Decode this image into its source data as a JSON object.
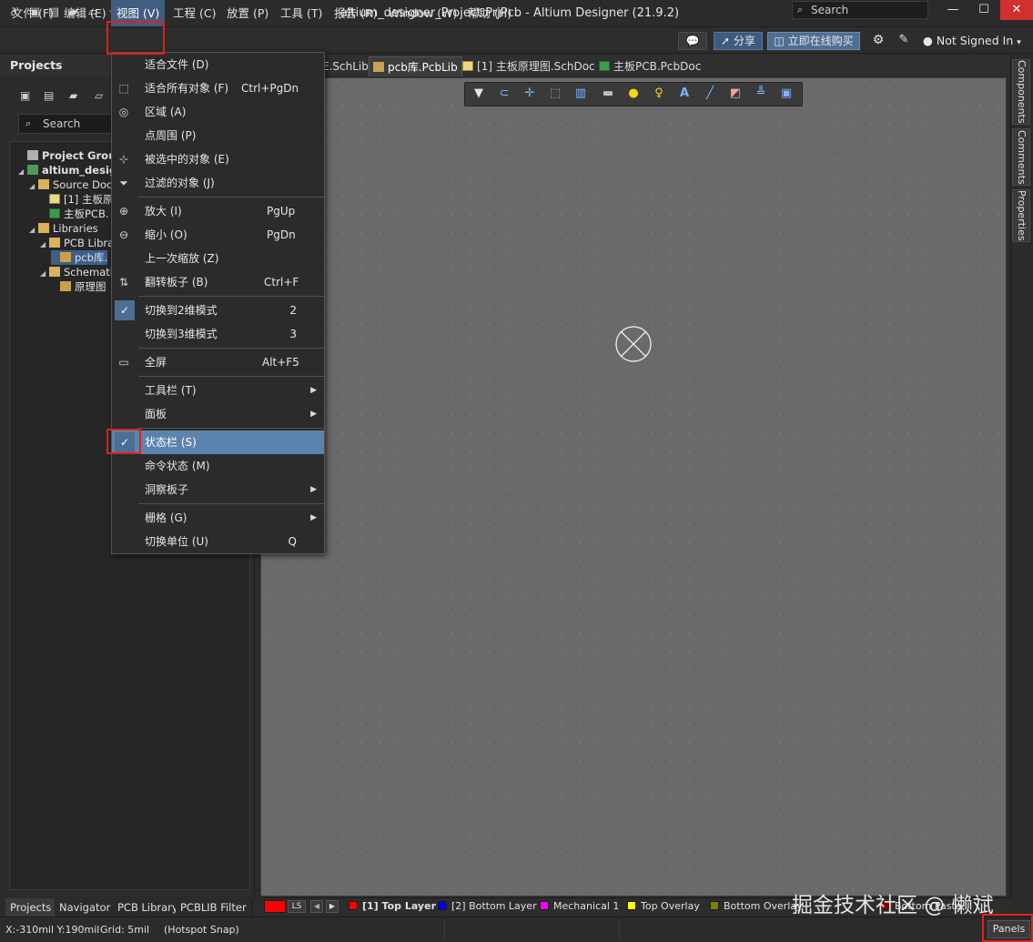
{
  "window": {
    "title": "altium_designer_Project.PrjPcb - Altium Designer (21.9.2)",
    "search_placeholder": "Search",
    "minimize": "—",
    "maximize": "☐",
    "close": "✕"
  },
  "menubar": {
    "items": [
      "文件 (F)",
      "编辑 (E)",
      "视图 (V)",
      "工程 (C)",
      "放置 (P)",
      "工具 (T)",
      "报告 (R)",
      "Window (W)",
      "帮助 (H)"
    ],
    "active_index": 2,
    "share_label": "分享",
    "buy_label": "立即在线购买",
    "signin_label": "Not Signed In"
  },
  "projects_panel": {
    "title": "Projects",
    "search_placeholder": "Search",
    "tree": [
      {
        "label": "Project Group 1.",
        "level": 0,
        "icon": "group",
        "bold": true
      },
      {
        "label": "altium_design",
        "level": 0,
        "icon": "proj",
        "bold": true,
        "tri": "◢"
      },
      {
        "label": "Source Docu",
        "level": 1,
        "icon": "folder",
        "tri": "◢"
      },
      {
        "label": "[1] 主板原",
        "level": 2,
        "icon": "sch"
      },
      {
        "label": "主板PCB.",
        "level": 2,
        "icon": "pcb"
      },
      {
        "label": "Libraries",
        "level": 1,
        "icon": "folder",
        "tri": "◢"
      },
      {
        "label": "PCB Libra",
        "level": 2,
        "icon": "folder",
        "tri": "◢"
      },
      {
        "label": "pcb库.",
        "level": 3,
        "icon": "lib",
        "selected": true
      },
      {
        "label": "Schematic",
        "level": 2,
        "icon": "folder",
        "tri": "◢"
      },
      {
        "label": "原理图",
        "level": 3,
        "icon": "lib"
      }
    ],
    "bottom_tabs": [
      "Projects",
      "Navigator",
      "PCB Library",
      "PCBLIB Filter"
    ]
  },
  "doc_tabs": [
    {
      "label": "E.SchLib"
    },
    {
      "label": "pcb库.PcbLib",
      "active": true
    },
    {
      "label": "[1] 主板原理图.SchDoc"
    },
    {
      "label": "主板PCB.PcbDoc"
    }
  ],
  "right_panels": [
    "Components",
    "Comments",
    "Properties"
  ],
  "view_menu": {
    "items": [
      {
        "label": "适合文件 (D)",
        "shortcut": "",
        "icon": ""
      },
      {
        "label": "适合所有对象 (F)",
        "shortcut": "Ctrl+PgDn",
        "icon": "fit-all-icon"
      },
      {
        "label": "区域 (A)",
        "shortcut": "",
        "icon": "area-icon"
      },
      {
        "label": "点周围 (P)",
        "shortcut": "",
        "icon": ""
      },
      {
        "label": "被选中的对象 (E)",
        "shortcut": "",
        "icon": "selected-icon"
      },
      {
        "label": "过滤的对象 (J)",
        "shortcut": "",
        "icon": "filter-icon"
      },
      {
        "label": "放大 (I)",
        "shortcut": "PgUp",
        "icon": "zoom-in-icon"
      },
      {
        "label": "缩小 (O)",
        "shortcut": "PgDn",
        "icon": "zoom-out-icon"
      },
      {
        "label": "上一次缩放 (Z)",
        "shortcut": "",
        "icon": ""
      },
      {
        "label": "翻转板子 (B)",
        "shortcut": "Ctrl+F",
        "icon": "flip-board-icon"
      },
      {
        "label": "切换到2维模式",
        "shortcut": "2",
        "checked": true
      },
      {
        "label": "切换到3维模式",
        "shortcut": "3"
      },
      {
        "label": "全屏",
        "shortcut": "Alt+F5",
        "icon": "fullscreen-icon"
      },
      {
        "label": "工具栏 (T)",
        "submenu": true
      },
      {
        "label": "面板",
        "submenu": true
      },
      {
        "label": "状态栏 (S)",
        "checked": true,
        "highlighted": true
      },
      {
        "label": "命令状态 (M)"
      },
      {
        "label": "洞察板子",
        "submenu": true
      },
      {
        "label": "栅格 (G)",
        "submenu": true
      },
      {
        "label": "切换单位 (U)",
        "shortcut": "Q"
      }
    ]
  },
  "layer_bar": {
    "ls_label": "LS",
    "layers": [
      {
        "name": "[1] Top Layer",
        "color": "#ff0000",
        "active": true
      },
      {
        "name": "[2] Bottom Layer",
        "color": "#0000ff"
      },
      {
        "name": "Mechanical 1",
        "color": "#ff00ff"
      },
      {
        "name": "Top Overlay",
        "color": "#ffff00"
      },
      {
        "name": "Bottom Overlay",
        "color": "#808000"
      },
      {
        "name": "Bottom Paste",
        "color": "#800000"
      }
    ]
  },
  "statusbar": {
    "coords": "X:-310mil Y:190mil",
    "grid": "Grid: 5mil",
    "snap": "(Hotspot Snap)",
    "panels_label": "Panels"
  },
  "watermark": "掘金技术社区 @ 懒斌",
  "colors": {
    "accent": "#415e82",
    "highlight": "#5c83ad",
    "annotation_red": "#e0201b",
    "canvas": "#6a6a6a"
  }
}
